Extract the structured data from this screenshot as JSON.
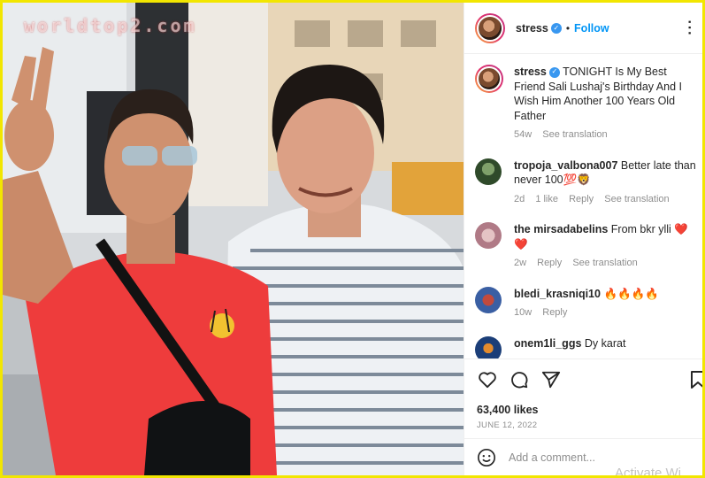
{
  "watermark": "worldtop2.com",
  "post": {
    "username": "stress",
    "follow_label": "Follow",
    "caption": "TONIGHT Is My Best Friend Sali Lushaj's Birthday And I Wish Him Another 100 Years Old Father",
    "caption_age": "54w",
    "see_translation": "See translation",
    "likes": "63,400 likes",
    "date": "JUNE 12, 2022",
    "add_comment_placeholder": "Add a comment...",
    "activate_text": "Activate Wi"
  },
  "comments": [
    {
      "user": "tropoja_valbona007",
      "text": "Better late than never 100💯🦁",
      "age": "2d",
      "likes": "1 like",
      "reply": "Reply",
      "translate": "See translation"
    },
    {
      "user": "the mirsadabelins",
      "text": "From bkr ylli ❤️ ❤️",
      "age": "2w",
      "reply": "Reply",
      "translate": "See translation"
    },
    {
      "user": "bledi_krasniqi10",
      "text": "🔥🔥🔥🔥",
      "age": "10w",
      "reply": "Reply"
    },
    {
      "user": "onem1li_ggs",
      "text": "Dy karat"
    }
  ],
  "colors": {
    "accent": "#0095f6",
    "verified": "#3897f0",
    "frame": "#f2e600",
    "secondary_text": "#8e8e8e"
  },
  "icons": [
    "more-options-icon",
    "verified-icon",
    "heart-icon",
    "comment-icon",
    "share-icon",
    "bookmark-icon",
    "emoji-icon"
  ]
}
